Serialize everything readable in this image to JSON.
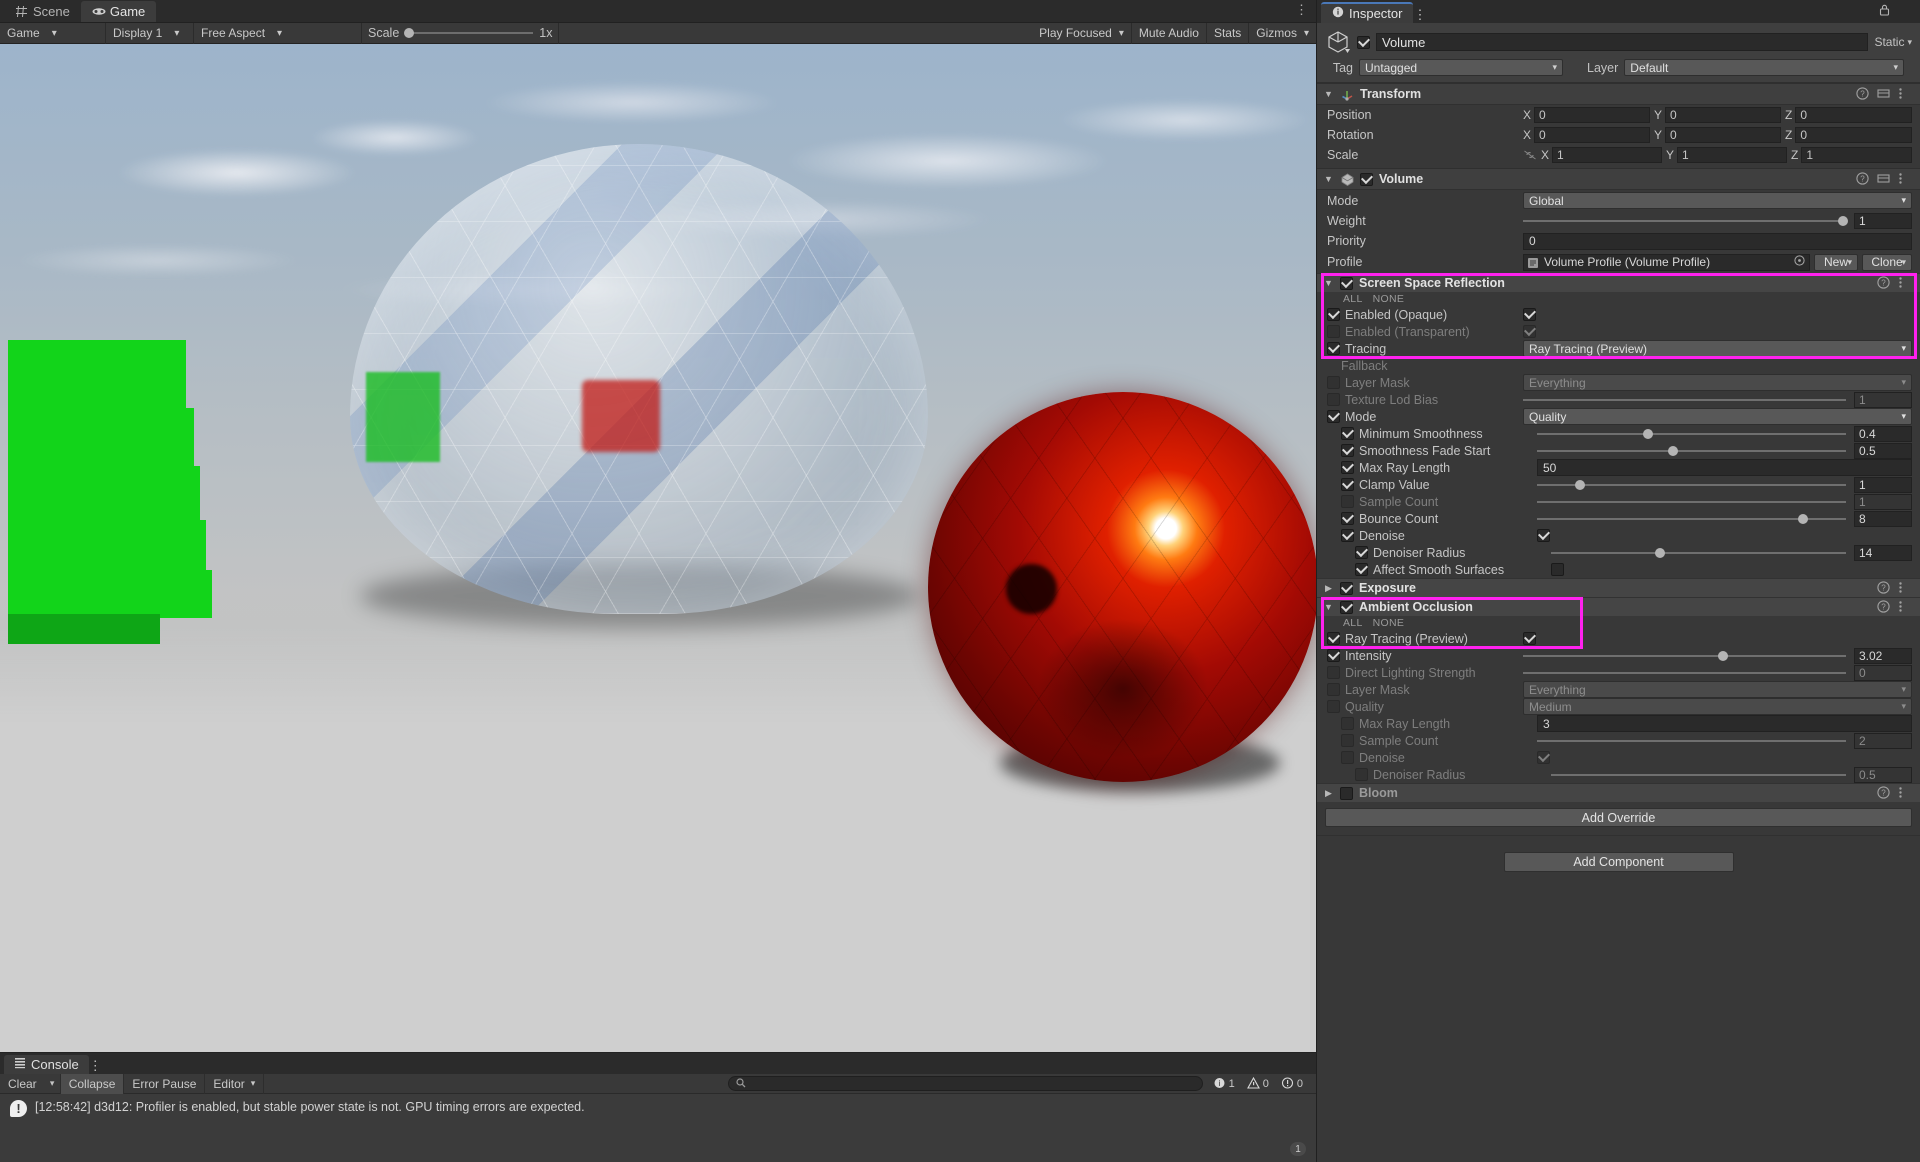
{
  "gameview": {
    "tabs": [
      {
        "label": "Scene",
        "icon": "grid-icon",
        "active": false
      },
      {
        "label": "Game",
        "icon": "gamepad-icon",
        "active": true
      }
    ],
    "toolbar": {
      "display_target": "Game",
      "display": "Display 1",
      "aspect": "Free Aspect",
      "scale_label": "Scale",
      "scale_value": "1x",
      "play_focused": "Play Focused",
      "mute_audio": "Mute Audio",
      "stats": "Stats",
      "gizmos": "Gizmos"
    }
  },
  "console": {
    "tab_label": "Console",
    "buttons": {
      "clear": "Clear",
      "collapse": "Collapse",
      "error_pause": "Error Pause",
      "editor": "Editor"
    },
    "search_placeholder": "",
    "counters": {
      "info": "1",
      "warning": "0",
      "error": "0"
    },
    "messages": [
      {
        "text": "[12:58:42] d3d12: Profiler is enabled, but stable power state is not. GPU timing errors are expected.",
        "type": "warning"
      }
    ],
    "message_count": "1"
  },
  "inspector": {
    "tab_label": "Inspector",
    "object": {
      "name": "Volume",
      "enabled": true,
      "static_label": "Static",
      "tag_label": "Tag",
      "tag_value": "Untagged",
      "layer_label": "Layer",
      "layer_value": "Default"
    },
    "transform": {
      "title": "Transform",
      "rows": [
        {
          "label": "Position",
          "x": "0",
          "y": "0",
          "z": "0"
        },
        {
          "label": "Rotation",
          "x": "0",
          "y": "0",
          "z": "0"
        },
        {
          "label": "Scale",
          "x": "1",
          "y": "1",
          "z": "1"
        }
      ],
      "axis_labels": [
        "X",
        "Y",
        "Z"
      ]
    },
    "volume": {
      "title": "Volume",
      "enabled": true,
      "mode_label": "Mode",
      "mode_value": "Global",
      "weight_label": "Weight",
      "weight_value": "1",
      "priority_label": "Priority",
      "priority_value": "0",
      "profile_label": "Profile",
      "profile_value": "Volume Profile (Volume Profile)",
      "new_button": "New",
      "clone_button": "Clone"
    },
    "ssr": {
      "title": "Screen Space Reflection",
      "enabled": true,
      "all_label": "ALL",
      "none_label": "NONE",
      "rows": [
        {
          "label": "Enabled (Opaque)",
          "type": "checkbox",
          "checked": true,
          "value": true,
          "dim": false,
          "indent": 0
        },
        {
          "label": "Enabled (Transparent)",
          "type": "checkbox",
          "checked": false,
          "value": true,
          "dim": true,
          "indent": 0
        },
        {
          "label": "Tracing",
          "type": "dropdown",
          "checked": true,
          "value": "Ray Tracing (Preview)",
          "dim": false,
          "indent": 0
        },
        {
          "label": "Fallback",
          "type": "header",
          "checked": false,
          "value": "",
          "dim": true,
          "indent": 0
        },
        {
          "label": "Layer Mask",
          "type": "dropdown",
          "checked": false,
          "value": "Everything",
          "dim": true,
          "indent": 0
        },
        {
          "label": "Texture Lod Bias",
          "type": "slider",
          "checked": false,
          "value": "1",
          "pct": 26,
          "dim": true,
          "indent": 0
        },
        {
          "label": "Mode",
          "type": "dropdown",
          "checked": true,
          "value": "Quality",
          "dim": false,
          "indent": 0
        },
        {
          "label": "Minimum Smoothness",
          "type": "slider",
          "checked": true,
          "value": "0.4",
          "pct": 36,
          "dim": false,
          "indent": 1
        },
        {
          "label": "Smoothness Fade Start",
          "type": "slider",
          "checked": true,
          "value": "0.5",
          "pct": 44,
          "dim": false,
          "indent": 1
        },
        {
          "label": "Max Ray Length",
          "type": "field",
          "checked": true,
          "value": "50",
          "dim": false,
          "indent": 1
        },
        {
          "label": "Clamp Value",
          "type": "slider",
          "checked": true,
          "value": "1",
          "pct": 14,
          "dim": false,
          "indent": 1
        },
        {
          "label": "Sample Count",
          "type": "slider",
          "checked": false,
          "value": "1",
          "pct": 4,
          "dim": true,
          "indent": 1
        },
        {
          "label": "Bounce Count",
          "type": "slider",
          "checked": true,
          "value": "8",
          "pct": 86,
          "dim": false,
          "indent": 1
        },
        {
          "label": "Denoise",
          "type": "checkbox",
          "checked": true,
          "value": true,
          "dim": false,
          "indent": 1
        },
        {
          "label": "Denoiser Radius",
          "type": "slider",
          "checked": true,
          "value": "14",
          "pct": 37,
          "dim": false,
          "indent": 2
        },
        {
          "label": "Affect Smooth Surfaces",
          "type": "checkbox",
          "checked": true,
          "value": false,
          "dim": false,
          "indent": 2
        }
      ]
    },
    "exposure": {
      "title": "Exposure",
      "enabled": true
    },
    "ao": {
      "title": "Ambient Occlusion",
      "enabled": true,
      "all_label": "ALL",
      "none_label": "NONE",
      "rows": [
        {
          "label": "Ray Tracing (Preview)",
          "type": "checkbox",
          "checked": true,
          "value": true,
          "dim": false,
          "indent": 0
        },
        {
          "label": "Intensity",
          "type": "slider",
          "checked": true,
          "value": "3.02",
          "pct": 62,
          "dim": false,
          "indent": 0
        },
        {
          "label": "Direct Lighting Strength",
          "type": "slider",
          "checked": false,
          "value": "0",
          "pct": 0,
          "dim": true,
          "indent": 0
        },
        {
          "label": "Layer Mask",
          "type": "dropdown",
          "checked": false,
          "value": "Everything",
          "dim": true,
          "indent": 0
        },
        {
          "label": "Quality",
          "type": "dropdown",
          "checked": false,
          "value": "Medium",
          "dim": true,
          "indent": 0
        },
        {
          "label": "Max Ray Length",
          "type": "field",
          "checked": false,
          "value": "3",
          "dim": true,
          "indent": 1
        },
        {
          "label": "Sample Count",
          "type": "slider",
          "checked": false,
          "value": "2",
          "pct": 2,
          "dim": true,
          "indent": 1
        },
        {
          "label": "Denoise",
          "type": "checkbox",
          "checked": false,
          "value": true,
          "dim": true,
          "indent": 1
        },
        {
          "label": "Denoiser Radius",
          "type": "slider",
          "checked": false,
          "value": "0.5",
          "pct": 42,
          "dim": true,
          "indent": 2
        }
      ]
    },
    "bloom": {
      "title": "Bloom",
      "enabled": false
    },
    "add_override": "Add Override",
    "add_component": "Add Component"
  },
  "colors": {
    "highlight": "#ff21ef",
    "accent": "#4a78b8",
    "panel": "#383838"
  }
}
